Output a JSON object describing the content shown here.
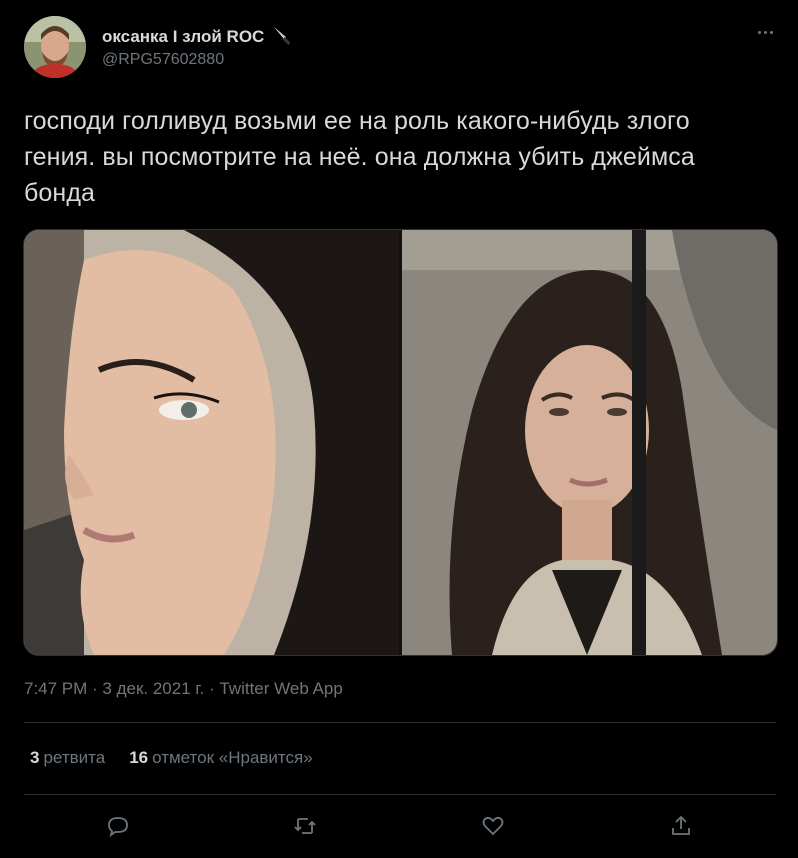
{
  "user": {
    "display_name": "оксанка I злой ROC",
    "handle": "@RPG57602880",
    "emoji_icon": "knife-icon"
  },
  "tweet": {
    "text": "господи голливуд возьми ее на роль какого-нибудь злого гения. вы посмотрите на неё. она должна убить джеймса бонда",
    "meta": "7:47 PM · 3 дек. 2021 г. · Twitter Web App"
  },
  "stats": {
    "retweets_count": "3",
    "retweets_label": "ретвита",
    "likes_count": "16",
    "likes_label": "отметок «Нравится»"
  },
  "actions": [
    "reply-icon",
    "retweet-icon",
    "like-icon",
    "share-icon"
  ],
  "colors": {
    "background": "#000000",
    "text": "#d9d9d9",
    "secondary": "#6e767d",
    "border": "#2f3336"
  }
}
